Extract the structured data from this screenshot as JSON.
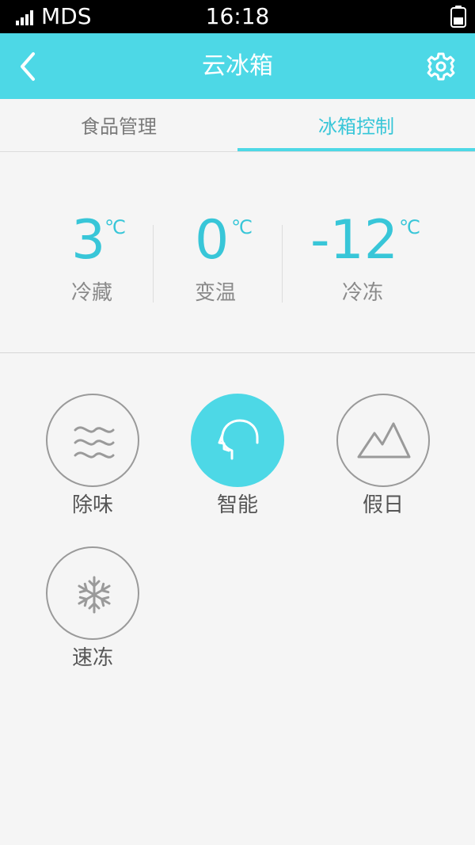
{
  "status_bar": {
    "carrier": "MDS",
    "time": "16:18"
  },
  "header": {
    "title": "云冰箱",
    "back_icon": "chevron-left-icon",
    "settings_icon": "gear-icon"
  },
  "tabs": [
    {
      "label": "食品管理",
      "active": false
    },
    {
      "label": "冰箱控制",
      "active": true
    }
  ],
  "temperatures": [
    {
      "value": "3",
      "unit": "℃",
      "label": "冷藏"
    },
    {
      "value": "0",
      "unit": "℃",
      "label": "变温"
    },
    {
      "value": "-12",
      "unit": "℃",
      "label": "冷冻"
    }
  ],
  "modes": [
    {
      "label": "除味",
      "icon": "waves-icon",
      "active": false
    },
    {
      "label": "智能",
      "icon": "head-icon",
      "active": true
    },
    {
      "label": "假日",
      "icon": "mountain-icon",
      "active": false
    },
    {
      "label": "速冻",
      "icon": "snowflake-icon",
      "active": false
    }
  ],
  "colors": {
    "accent": "#4dd8e6",
    "accent_text": "#38c6d8",
    "background": "#f5f5f5",
    "status_bar": "#000000"
  }
}
